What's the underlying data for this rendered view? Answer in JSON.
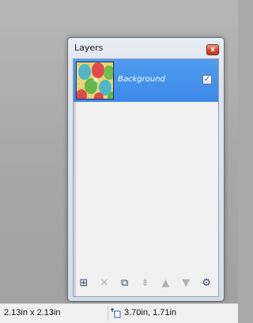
{
  "layers_panel": {
    "title": "Layers",
    "close_glyph": "x",
    "layers": [
      {
        "name": "Background",
        "visible": true,
        "selected": true
      }
    ],
    "toolbar": [
      {
        "name": "add-layer-icon",
        "glyph": "⊞",
        "enabled": true
      },
      {
        "name": "delete-layer-icon",
        "glyph": "✕",
        "enabled": false
      },
      {
        "name": "duplicate-layer-icon",
        "glyph": "⧉",
        "enabled": true
      },
      {
        "name": "merge-layer-down-icon",
        "glyph": "⇟",
        "enabled": false
      },
      {
        "name": "move-layer-up-icon",
        "glyph": "▲",
        "enabled": false
      },
      {
        "name": "move-layer-down-icon",
        "glyph": "▼",
        "enabled": false
      },
      {
        "name": "layer-properties-icon",
        "glyph": "⚙",
        "enabled": true
      }
    ],
    "colors": {
      "selection": "#3b8ae8"
    }
  },
  "status_bar": {
    "image_size": "2.13in x 2.13in",
    "cursor_position": "3.70in, 1.71in"
  }
}
